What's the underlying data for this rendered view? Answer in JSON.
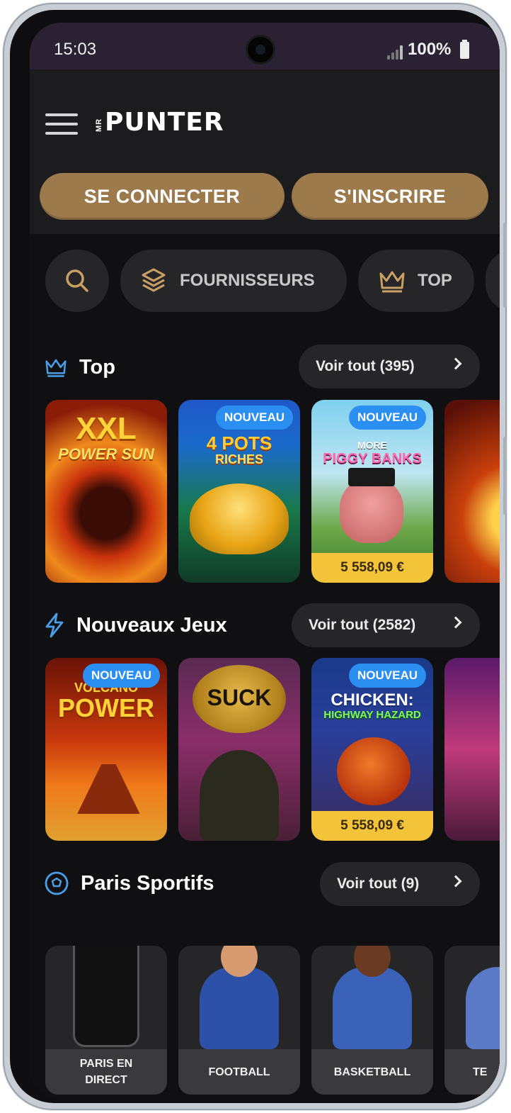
{
  "status_bar": {
    "time": "15:03",
    "battery": "100%"
  },
  "header": {
    "logo_prefix": "MR",
    "logo": "PUNTER",
    "login_label": "SE CONNECTER",
    "signup_label": "S'INSCRIRE"
  },
  "filters": {
    "providers_label": "FOURNISSEURS",
    "top_label": "TOP"
  },
  "sections": {
    "top": {
      "title": "Top",
      "view_all": "Voir tout (395)",
      "games": [
        {
          "title_line1": "XXL",
          "title_line2": "POWER SUN",
          "badge": "",
          "prize": ""
        },
        {
          "title_line1": "4 POTS",
          "title_line2": "RICHES",
          "badge": "NOUVEAU",
          "prize": ""
        },
        {
          "title_line1": "MORE",
          "title_line2": "PIGGY BANKS",
          "badge": "NOUVEAU",
          "prize": "5 558,09 €"
        }
      ]
    },
    "new_games": {
      "title": "Nouveaux Jeux",
      "view_all": "Voir tout (2582)",
      "games": [
        {
          "title_line1": "VOLCANO",
          "title_line2": "POWER",
          "badge": "NOUVEAU",
          "prize": ""
        },
        {
          "title_line1": "SUCK",
          "title_line2": "",
          "badge": "",
          "prize": ""
        },
        {
          "title_line1": "CHICKEN:",
          "title_line2": "HIGHWAY HAZARD",
          "badge": "NOUVEAU",
          "prize": "5 558,09 €"
        }
      ]
    },
    "sports": {
      "title": "Paris Sportifs",
      "view_all": "Voir tout (9)",
      "items": [
        {
          "label_line1": "PARIS EN",
          "label_line2": "DIRECT"
        },
        {
          "label_line1": "FOOTBALL",
          "label_line2": ""
        },
        {
          "label_line1": "BASKETBALL",
          "label_line2": ""
        },
        {
          "label_line1": "TE",
          "label_line2": ""
        }
      ]
    }
  },
  "colors": {
    "gold_button": "#9c7a4b",
    "badge_blue": "#2a8ff0",
    "prize_yellow": "#f3c43a",
    "icon_gold": "#c9a063",
    "icon_blue": "#4a9ee8"
  }
}
